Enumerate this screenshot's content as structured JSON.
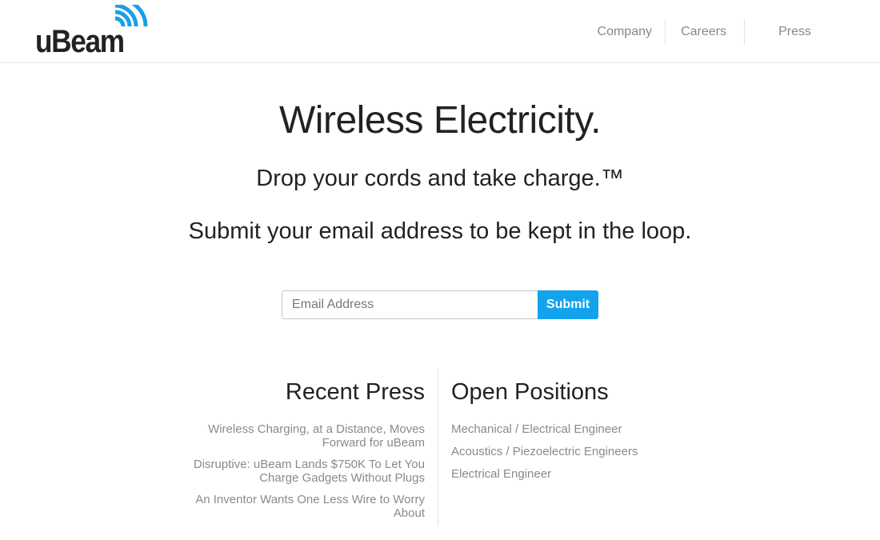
{
  "header": {
    "logo_text": "uBeam",
    "nav": [
      {
        "label": "Company"
      },
      {
        "label": "Careers"
      },
      {
        "label": "Press"
      }
    ]
  },
  "hero": {
    "title": "Wireless Electricity.",
    "tagline": "Drop your cords and take charge.™",
    "cta": "Submit your email address to be kept in the loop."
  },
  "signup": {
    "email_placeholder": "Email Address",
    "email_value": "",
    "submit_label": "Submit"
  },
  "recent_press": {
    "heading": "Recent Press",
    "items": [
      {
        "title": "Wireless Charging, at a Distance, Moves Forward for uBeam"
      },
      {
        "title": "Disruptive: uBeam Lands $750K To Let You Charge Gadgets Without Plugs"
      },
      {
        "title": "An Inventor Wants One Less Wire to Worry About"
      }
    ]
  },
  "open_positions": {
    "heading": "Open Positions",
    "items": [
      {
        "title": "Mechanical / Electrical Engineer"
      },
      {
        "title": "Acoustics / Piezoelectric Engineers"
      },
      {
        "title": "Electrical Engineer"
      }
    ]
  },
  "colors": {
    "accent": "#12a3ec",
    "logo_waves": "#1a9fe6",
    "text_dark": "#222222",
    "text_muted": "#8a8a8a",
    "divider": "#e3e3e3"
  },
  "icons": {
    "logo_mark": "wireless-signal-icon"
  }
}
